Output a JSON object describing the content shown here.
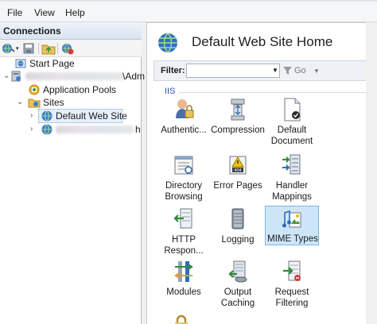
{
  "menu": [
    "File",
    "View",
    "Help"
  ],
  "connections": {
    "title": "Connections",
    "tree": {
      "start_page": "Start Page",
      "server_suffix": "\\Adm",
      "application_pools": "Application Pools",
      "sites": "Sites",
      "default_web_site": "Default Web Site",
      "second_site_suffix": "h"
    }
  },
  "main": {
    "title": "Default Web Site Home",
    "filter_label": "Filter:",
    "filter_value": "",
    "go_label": "Go",
    "section": "IIS",
    "features": [
      "Authentic...",
      "Compression",
      "Default Document",
      "Directory Browsing",
      "Error Pages",
      "Handler Mappings",
      "HTTP Respon...",
      "Logging",
      "MIME Types",
      "Modules",
      "Output Caching",
      "Request Filtering"
    ],
    "selected_feature": "MIME Types"
  },
  "colors": {
    "accent": "#2c5aa0",
    "selection": "#cde6f7",
    "header_gradient_top": "#eef3f9"
  }
}
